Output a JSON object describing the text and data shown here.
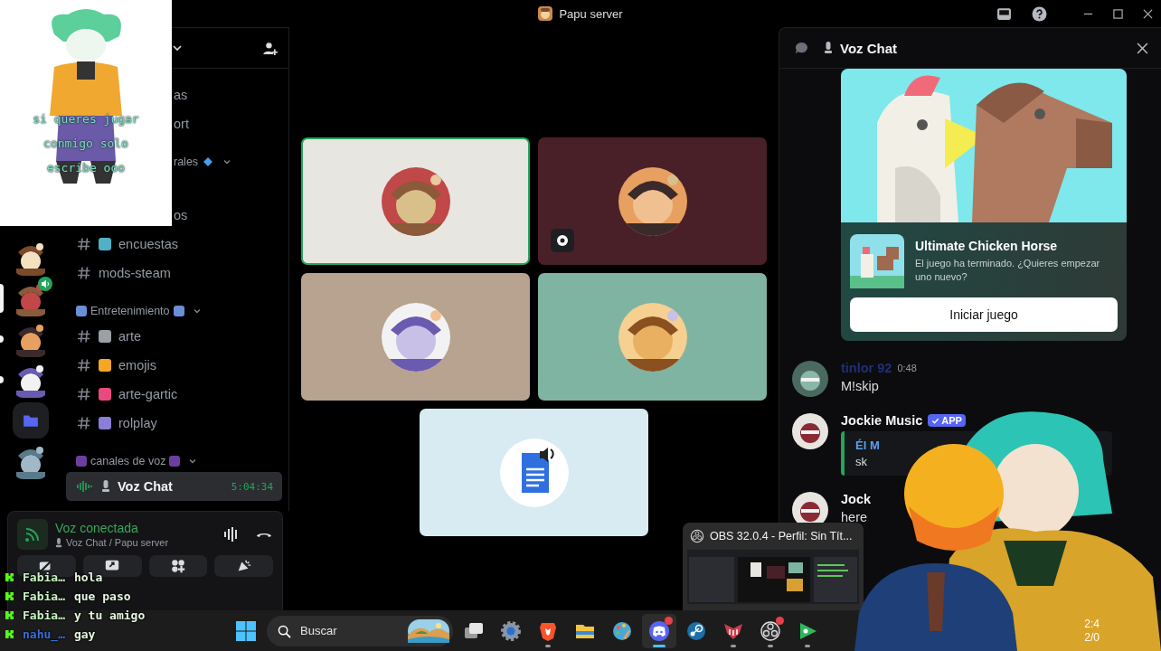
{
  "window": {
    "title": "Papu server"
  },
  "sticker": {
    "caption": "si queres jugar conmigo solo escribe ooo"
  },
  "servers": [
    {
      "kind": "picture",
      "selected": false,
      "unread": false,
      "speaking": false
    },
    {
      "kind": "picture",
      "selected": true,
      "unread": false,
      "speaking": true
    },
    {
      "kind": "picture",
      "selected": false,
      "unread": true,
      "speaking": false
    },
    {
      "kind": "picture",
      "selected": false,
      "unread": true,
      "speaking": false
    },
    {
      "kind": "folder",
      "selected": false,
      "unread": false,
      "speaking": false
    },
    {
      "kind": "picture",
      "selected": false,
      "unread": false,
      "speaking": false
    }
  ],
  "channels": [
    {
      "kind": "partial",
      "name": "as"
    },
    {
      "kind": "partial",
      "name": "ort"
    },
    {
      "kind": "partial-category",
      "name": "rales",
      "color": "#4a9de8"
    },
    {
      "kind": "partial",
      "name": "os"
    },
    {
      "kind": "text",
      "name": "encuestas",
      "color": "#4fb0c6"
    },
    {
      "kind": "text",
      "name": "mods-steam"
    },
    {
      "kind": "category",
      "name": "Entretenimiento",
      "color": "#6b8fd6"
    },
    {
      "kind": "text",
      "name": "arte",
      "color": "#9aa0a6"
    },
    {
      "kind": "text",
      "name": "emojis",
      "color": "#f5a623"
    },
    {
      "kind": "text",
      "name": "arte-gartic",
      "color": "#e84a7f"
    },
    {
      "kind": "text",
      "name": "rolplay",
      "color": "#8a7fd6"
    },
    {
      "kind": "category",
      "name": "canales de voz",
      "color": "#6b3fa0"
    },
    {
      "kind": "voice",
      "name": "Voz Chat",
      "time": "5:04:34",
      "selected": true
    }
  ],
  "voice_panel": {
    "status": "Voz conectada",
    "channel": "Voz Chat / Papu server"
  },
  "stage": {
    "tiles": [
      {
        "kind": "avatar",
        "color": "#e8e6e1",
        "speaking": true,
        "activity": false
      },
      {
        "kind": "avatar",
        "color": "#4a2028",
        "speaking": false,
        "activity": true
      },
      {
        "kind": "avatar",
        "color": "#b8a290",
        "speaking": false,
        "activity": false
      },
      {
        "kind": "avatar",
        "color": "#7fb4a2",
        "speaking": false,
        "activity": false
      },
      {
        "kind": "app",
        "color": "#d8ebf2",
        "speaking": false,
        "activity": false
      }
    ]
  },
  "right_panel": {
    "title": "Voz Chat",
    "activity": {
      "title": "Ultimate Chicken Horse",
      "subtitle": "El juego ha terminado. ¿Quieres empezar uno nuevo?",
      "button": "Iniciar juego"
    },
    "messages": [
      {
        "author": "tinlor 92",
        "color": "#1f2f7a",
        "time": "0:48",
        "text": "M!skip"
      },
      {
        "author": "Jockie Music",
        "color": "#f2f3f5",
        "badge": "APP",
        "embed": {
          "title": "Él M",
          "text": "sk"
        }
      },
      {
        "author": "Jock",
        "color": "#f2f3f5",
        "text": "here"
      }
    ]
  },
  "chat_overlay": [
    {
      "user": "Fabia…",
      "text": "hola",
      "color": "#c8f5c0"
    },
    {
      "user": "Fabia…",
      "text": "que paso",
      "color": "#c8f5c0"
    },
    {
      "user": "Fabia…",
      "text": "y tu amigo",
      "color": "#c8f5c0"
    },
    {
      "user": "nahu_…",
      "text": "gay",
      "color": "#3a6fd8"
    }
  ],
  "obs_preview": {
    "title": "OBS 32.0.4 - Perfil: Sin Tít..."
  },
  "taskbar": {
    "search": {
      "placeholder": "Buscar"
    },
    "apps": [
      {
        "kind": "taskview",
        "active": false,
        "running": false,
        "badge": false
      },
      {
        "kind": "settings",
        "active": false,
        "running": false,
        "badge": false
      },
      {
        "kind": "browser",
        "active": false,
        "running": true,
        "badge": false
      },
      {
        "kind": "files",
        "active": false,
        "running": false,
        "badge": false
      },
      {
        "kind": "paint",
        "active": false,
        "running": false,
        "badge": false
      },
      {
        "kind": "discord",
        "active": true,
        "running": true,
        "badge": true
      },
      {
        "kind": "steam",
        "active": false,
        "running": false,
        "badge": false
      },
      {
        "kind": "mod",
        "active": false,
        "running": true,
        "badge": false
      },
      {
        "kind": "obs",
        "active": false,
        "running": true,
        "badge": true
      },
      {
        "kind": "play",
        "active": false,
        "running": true,
        "badge": false
      }
    ],
    "clock": {
      "time": "2:4",
      "date": "2/0"
    }
  }
}
